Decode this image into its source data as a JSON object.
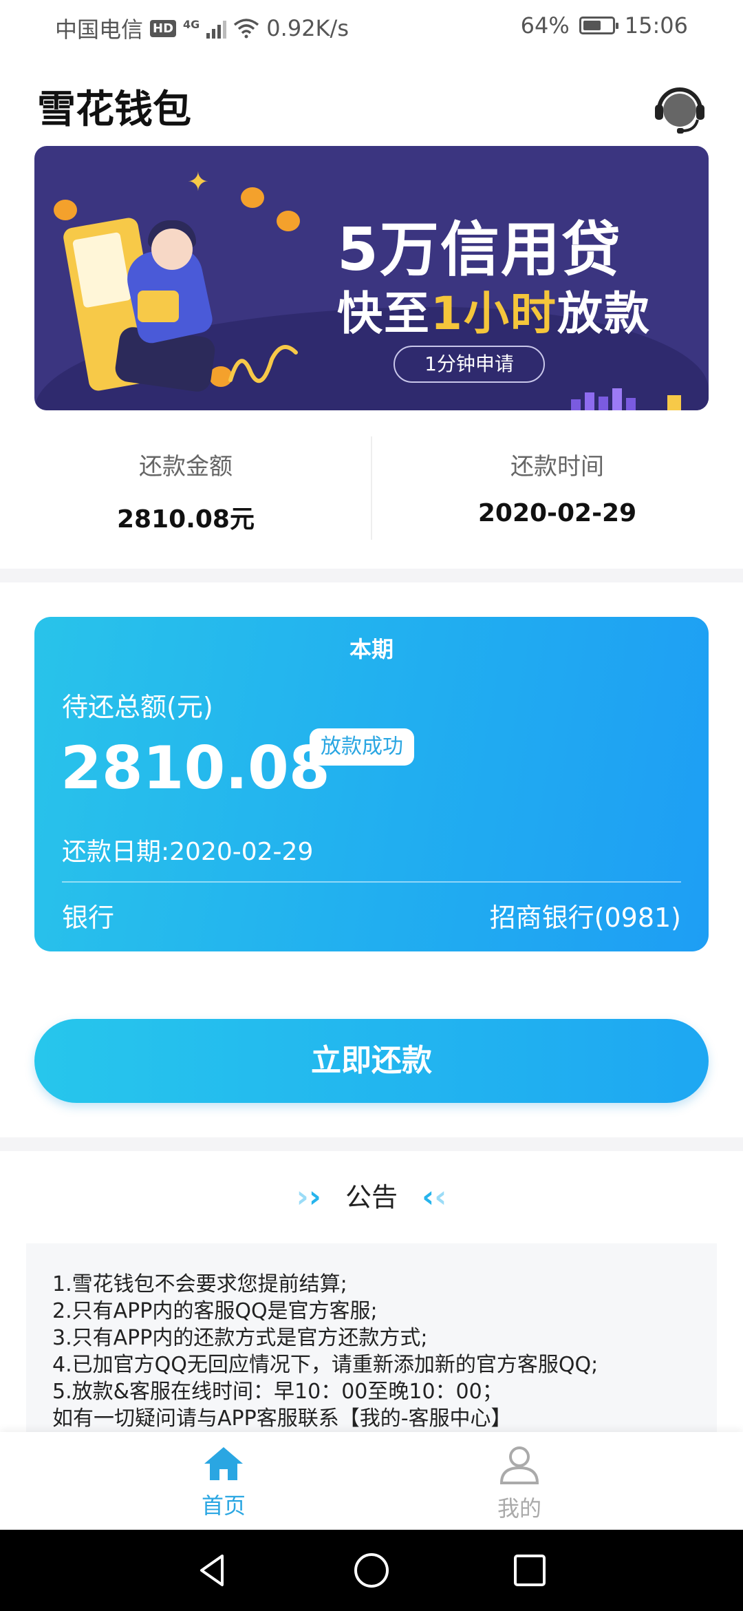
{
  "status_bar": {
    "carrier": "中国电信",
    "hd": "HD",
    "network": "4G",
    "speed": "0.92K/s",
    "battery": "64%",
    "battery_level": 0.64,
    "time": "15:06"
  },
  "header": {
    "title": "雪花钱包",
    "support_icon": "headset-icon"
  },
  "banner": {
    "title_line1": "5万信用贷",
    "title_line2_a": "快至",
    "title_line2_b": "1小时",
    "title_line2_c": "放款",
    "pill": "1分钟申请"
  },
  "summary": {
    "amount_label": "还款金额",
    "amount_value": "2810.08元",
    "time_label": "还款时间",
    "time_value": "2020-02-29"
  },
  "card": {
    "period": "本期",
    "pending_label": "待还总额(元)",
    "amount": "2810.08",
    "badge": "放款成功",
    "date": "还款日期:2020-02-29",
    "bank_label": "银行",
    "bank_value": "招商银行(0981)"
  },
  "repay_button": "立即还款",
  "notice": {
    "title": "公告",
    "items": [
      "1.雪花钱包不会要求您提前结算;",
      "2.只有APP内的客服QQ是官方客服;",
      "3.只有APP内的还款方式是官方还款方式;",
      "4.已加官方QQ无回应情况下，请重新添加新的官方客服QQ;",
      "5.放款&客服在线时间：早10：00至晚10：00；",
      "如有一切疑问请与APP客服联系【我的-客服中心】"
    ]
  },
  "tabs": {
    "home": "首页",
    "mine": "我的"
  },
  "colors": {
    "accent": "#21aef0",
    "banner_bg": "#3b3580",
    "highlight": "#f5c63b"
  }
}
